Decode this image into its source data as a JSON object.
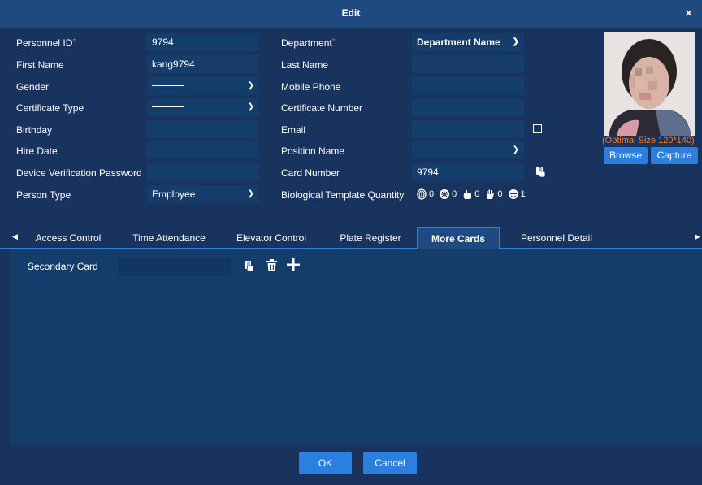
{
  "dialog": {
    "title": "Edit",
    "close": "×"
  },
  "form": {
    "personnel_id": {
      "label": "Personnel ID",
      "required": "*",
      "value": "9794"
    },
    "first_name": {
      "label": "First Name",
      "value": "kang9794"
    },
    "gender": {
      "label": "Gender"
    },
    "certificate_type": {
      "label": "Certificate Type"
    },
    "birthday": {
      "label": "Birthday",
      "value": ""
    },
    "hire_date": {
      "label": "Hire Date",
      "value": ""
    },
    "device_verification_password": {
      "label": "Device Verification Password",
      "value": ""
    },
    "person_type": {
      "label": "Person Type",
      "value": "Employee"
    },
    "department": {
      "label": "Department",
      "required": "*",
      "value": "Department Name"
    },
    "last_name": {
      "label": "Last Name",
      "value": ""
    },
    "mobile_phone": {
      "label": "Mobile Phone",
      "value": ""
    },
    "certificate_number": {
      "label": "Certificate Number",
      "value": ""
    },
    "email": {
      "label": "Email",
      "value": ""
    },
    "position_name": {
      "label": "Position Name",
      "value": ""
    },
    "card_number": {
      "label": "Card Number",
      "value": "9794"
    },
    "biological_template_quantity": {
      "label": "Biological Template Quantity",
      "counts": {
        "fingerprint": "0",
        "finger_vein": "0",
        "palm": "0",
        "palm_vein": "0",
        "face": "1"
      }
    }
  },
  "photo": {
    "optimal_size": "(Optimal Size 120*140)",
    "browse_label": "Browse",
    "capture_label": "Capture"
  },
  "tabs": {
    "items": [
      {
        "label": "Access Control"
      },
      {
        "label": "Time Attendance"
      },
      {
        "label": "Elevator Control"
      },
      {
        "label": "Plate Register"
      },
      {
        "label": "More Cards"
      },
      {
        "label": "Personnel Detail"
      }
    ],
    "active_index": 4
  },
  "more_cards": {
    "secondary_card_label": "Secondary Card",
    "secondary_card_value": ""
  },
  "footer": {
    "ok_label": "OK",
    "cancel_label": "Cancel"
  },
  "colors": {
    "background": "#18345e",
    "title_bar": "#1e4a80",
    "field": "#153d6c",
    "accent": "#2a7fe0",
    "required": "#e05a4a",
    "hint": "#ff7a1a"
  }
}
